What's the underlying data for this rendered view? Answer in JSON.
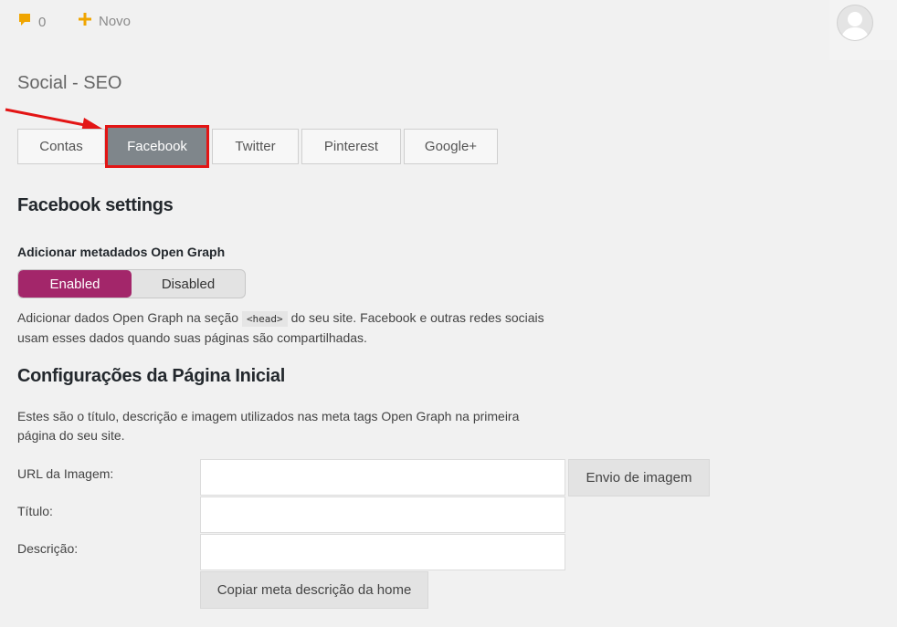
{
  "topbar": {
    "comment_count": "0",
    "new_label": "Novo",
    "comment_icon": "speech-bubble-icon",
    "new_icon": "plus-icon",
    "accent_color": "#f0a500"
  },
  "page": {
    "title": "Social - SEO"
  },
  "tabs": [
    {
      "label": "Contas"
    },
    {
      "label": "Facebook",
      "active": true
    },
    {
      "label": "Twitter"
    },
    {
      "label": "Pinterest"
    },
    {
      "label": "Google+"
    }
  ],
  "facebook": {
    "heading": "Facebook settings",
    "og_label": "Adicionar metadados Open Graph",
    "toggle": {
      "enabled": "Enabled",
      "disabled": "Disabled",
      "selected": "Enabled",
      "on_color": "#a3266a"
    },
    "og_desc_before": "Adicionar dados Open Graph na seção",
    "og_desc_code": "<head>",
    "og_desc_after": "do seu site. Facebook e outras redes sociais usam esses dados quando suas páginas são compartilhadas."
  },
  "home": {
    "heading": "Configurações da Página Inicial",
    "desc": "Estes são o título, descrição e imagem utilizados nas meta tags Open Graph na primeira página do seu site.",
    "fields": {
      "image_url_label": "URL da Imagem:",
      "title_label": "Título:",
      "description_label": "Descrição:",
      "image_url_value": "",
      "title_value": "",
      "description_value": ""
    },
    "upload_button": "Envio de imagem",
    "copy_button": "Copiar meta descrição da home"
  },
  "annotation": {
    "arrow_color": "#e31515",
    "highlight_color": "#e31515"
  }
}
